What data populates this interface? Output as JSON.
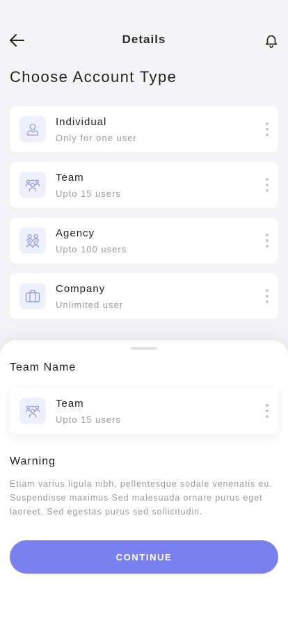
{
  "header": {
    "title": "Details",
    "back_icon": "arrow-left-icon",
    "notification_icon": "bell-icon"
  },
  "page_heading": "Choose Account Type",
  "account_types": [
    {
      "title": "Individual",
      "subtitle": "Only for one user",
      "icon": "user-icon"
    },
    {
      "title": "Team",
      "subtitle": "Upto 15 users",
      "icon": "team-icon"
    },
    {
      "title": "Agency",
      "subtitle": "Upto 100 users",
      "icon": "group-icon"
    },
    {
      "title": "Company",
      "subtitle": "Unlimited user",
      "icon": "briefcase-icon"
    }
  ],
  "sheet": {
    "team_name_label": "Team Name",
    "selected": {
      "title": "Team",
      "subtitle": "Upto 15 users",
      "icon": "team-icon"
    },
    "warning_label": "Warning",
    "warning_text": "Etiam varius ligula nibh, pellentesque sodale venenatis eu. Suspendisse maximus Sed malesuada ornare purus eget laoreet. Sed egestas purus sed sollicitudin.",
    "continue_label": "CONTINUE"
  },
  "colors": {
    "accent": "#7b80ef",
    "icon_bg": "#eef0fb",
    "icon_stroke": "#8f93db",
    "background": "#f4f4f6"
  }
}
